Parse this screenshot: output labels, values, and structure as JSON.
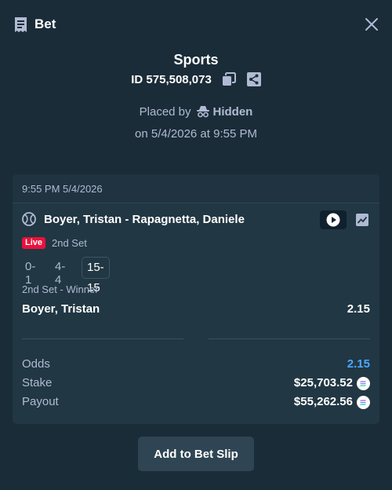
{
  "header": {
    "title": "Bet",
    "icon": "bet-slip-icon",
    "close_icon": "close-icon"
  },
  "summary": {
    "sport": "Sports",
    "id_label": "ID",
    "id_value": "575,508,073",
    "placed_by_label": "Placed by",
    "placed_by_user": "Hidden",
    "placed_on": "on 5/4/2026 at 9:55 PM"
  },
  "card": {
    "timestamp": "9:55 PM 5/4/2026",
    "match": "Boyer, Tristan - Rapagnetta, Daniele",
    "live_badge": "Live",
    "period": "2nd Set",
    "scores": [
      "0-1",
      "4-4",
      "15-15"
    ],
    "market": "2nd Set - Winner",
    "selection": "Boyer, Tristan",
    "selection_odds": "2.15",
    "totals": {
      "odds_label": "Odds",
      "odds_value": "2.15",
      "stake_label": "Stake",
      "stake_value": "$25,703.52",
      "payout_label": "Payout",
      "payout_value": "$55,262.56"
    }
  },
  "actions": {
    "add_to_slip": "Add to Bet Slip"
  },
  "colors": {
    "background": "#1a2c38",
    "card": "#213743",
    "accent_odds": "#4aa8ff",
    "live": "#e9113c",
    "button": "#2f4553"
  }
}
